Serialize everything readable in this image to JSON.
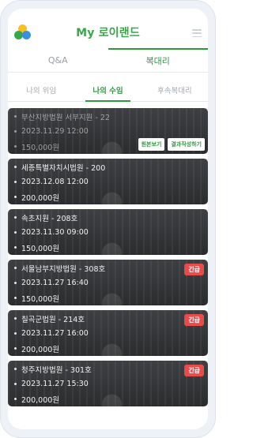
{
  "header": {
    "title": "My 로이랜드"
  },
  "tabs": [
    {
      "label": "Q&A"
    },
    {
      "label": "복대리"
    }
  ],
  "subtabs": [
    {
      "label": "나의 위임"
    },
    {
      "label": "나의 수임"
    },
    {
      "label": "후속복대리"
    }
  ],
  "cards": [
    {
      "court": "부산지방법원 서부지원 - 22",
      "datetime": "2023.11.29 12:00",
      "amount": "150,000원",
      "dim": true,
      "buttons": [
        "원본보기",
        "결과작성하기"
      ]
    },
    {
      "court": "세종특별자치시법원 - 200",
      "datetime": "2023.12.08 12:00",
      "amount": "200,000원"
    },
    {
      "court": "속초지원 - 208호",
      "datetime": "2023.11.30 09:00",
      "amount": "150,000원"
    },
    {
      "court": "서울남부지방법원 - 308호",
      "datetime": "2023.11.27 16:40",
      "amount": "150,000원",
      "badge": "긴급"
    },
    {
      "court": "칠곡군법원 - 214호",
      "datetime": "2023.11.27 16:00",
      "amount": "200,000원",
      "badge": "긴급"
    },
    {
      "court": "청주지방법원 - 301호",
      "datetime": "2023.11.27 15:30",
      "amount": "200,000원",
      "badge": "긴급"
    }
  ],
  "colors": {
    "accent": "#2e9a40",
    "badge": "#e94b4b"
  }
}
